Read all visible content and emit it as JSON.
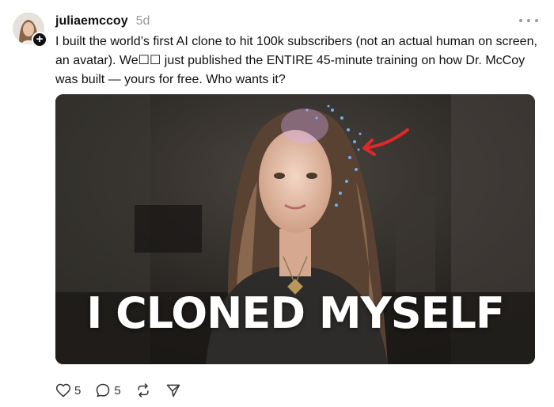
{
  "post": {
    "username": "juliaemccoy",
    "timestamp": "5d",
    "text": "I built the world’s first AI clone to hit 100k subscribers (not an actual human on screen, an avatar). We☐☐ just published the ENTIRE 45-minute training on how Dr. McCoy was built — yours for free. Who wants it?",
    "media": {
      "overlay_text": "I CLONED MYSELF"
    },
    "actions": {
      "likes": "5",
      "comments": "5"
    }
  },
  "icons": {
    "more": "more-horizontal-icon",
    "like": "heart-icon",
    "comment": "comment-icon",
    "repost": "repost-icon",
    "share": "send-icon"
  },
  "colors": {
    "text": "#111111",
    "muted": "#999999",
    "arrow": "#e0282b",
    "overlay": "#ffffff"
  }
}
